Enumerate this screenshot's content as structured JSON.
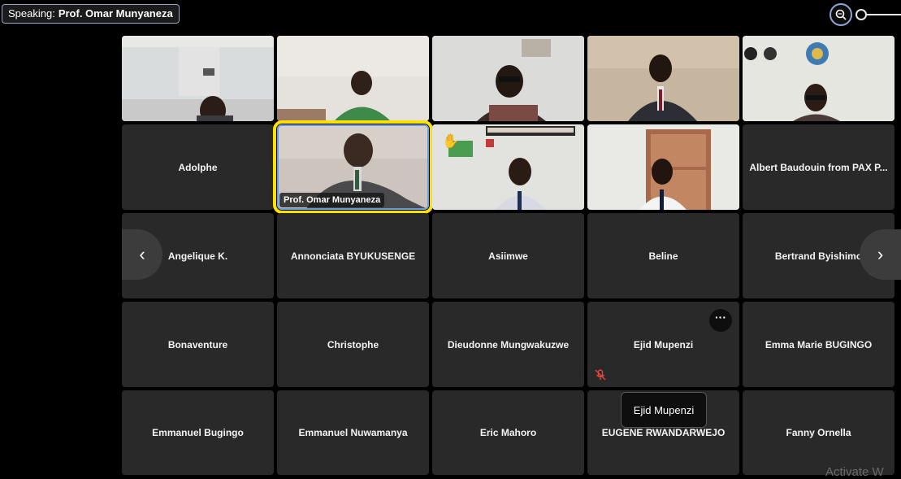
{
  "speaking": {
    "label": "Speaking:",
    "name": "Prof. Omar Munyaneza"
  },
  "video_tiles": [
    {
      "name": ""
    },
    {
      "name": ""
    },
    {
      "name": ""
    },
    {
      "name": ""
    },
    {
      "name": ""
    },
    {
      "name": "Prof. Omar Munyaneza",
      "active": true
    },
    {
      "name": "",
      "hand_raised": true,
      "hand_icon": "✋"
    },
    {
      "name": ""
    }
  ],
  "participants": [
    "Adolphe",
    "Albert Baudouin from PAX P...",
    "Angelique K.",
    "Annonciata BYUKUSENGE",
    "Asiimwe",
    "Beline",
    "Bertrand Byishimo",
    "Bonaventure",
    "Christophe",
    "Dieudonne Mungwakuzwe",
    "Ejid Mupenzi",
    "Emma Marie BUGINGO",
    "Emmanuel Bugingo",
    "Emmanuel Nuwamanya",
    "Eric Mahoro",
    "EUGENE RWANDARWEJO",
    "Fanny Ornella"
  ],
  "controls": {
    "prev": "‹",
    "next": "›",
    "more": "···"
  },
  "tooltip": "Ejid Mupenzi",
  "watermark": "Activate W",
  "colors": {
    "active_border": "#ffe100",
    "tile_bg": "#292929",
    "background": "#000000"
  },
  "icons": [
    "zoom-icon",
    "chevron-left-icon",
    "chevron-right-icon",
    "more-icon",
    "mic-off-icon",
    "raised-hand-icon"
  ]
}
